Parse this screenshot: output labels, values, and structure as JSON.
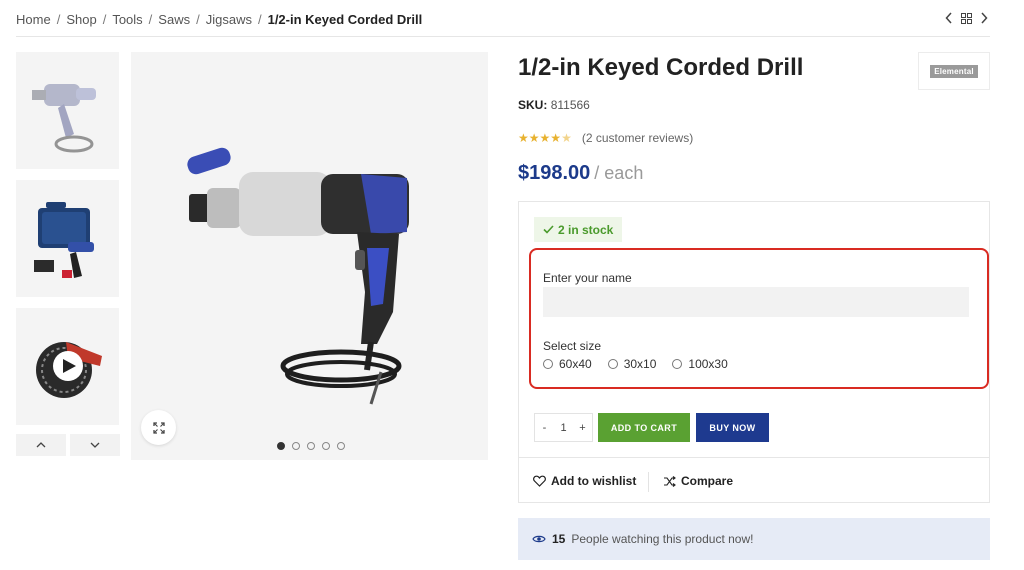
{
  "breadcrumb": {
    "items": [
      "Home",
      "Shop",
      "Tools",
      "Saws",
      "Jigsaws"
    ],
    "current": "1/2-in Keyed Corded Drill",
    "separator": "/"
  },
  "nav": {
    "prev_icon": "chevron-left-icon",
    "grid_icon": "grid-icon",
    "next_icon": "chevron-right-icon"
  },
  "gallery": {
    "thumbnails": [
      "drill-thumbnail",
      "drill-kit-thumbnail",
      "circular-saw-video-thumbnail"
    ],
    "dots_count": 5,
    "active_dot": 1
  },
  "product": {
    "title": "1/2-in Keyed Corded Drill",
    "brand": "Elemental",
    "sku_label": "SKU:",
    "sku": "811566",
    "rating": 4.5,
    "reviews": "(2 customer reviews)",
    "price": "$198.00",
    "price_unit": "/ each",
    "stock": "2 in stock"
  },
  "form": {
    "name_label": "Enter your name",
    "name_value": "",
    "name_placeholder": "",
    "size_label": "Select size",
    "sizes": [
      "60x40",
      "30x10",
      "100x30"
    ]
  },
  "cart": {
    "qty_minus": "-",
    "qty": "1",
    "qty_plus": "+",
    "add_to_cart": "ADD TO CART",
    "buy_now": "BUY NOW"
  },
  "actions": {
    "wishlist": "Add to wishlist",
    "compare": "Compare"
  },
  "watching": {
    "count": "15",
    "text": "People watching this product now!"
  },
  "colors": {
    "price": "#1c3a8a",
    "add_to_cart": "#5aa132",
    "buy_now": "#1e3a8f",
    "highlight_border": "#d92b22",
    "stock": "#4a9a2c",
    "star": "#e8b230"
  }
}
